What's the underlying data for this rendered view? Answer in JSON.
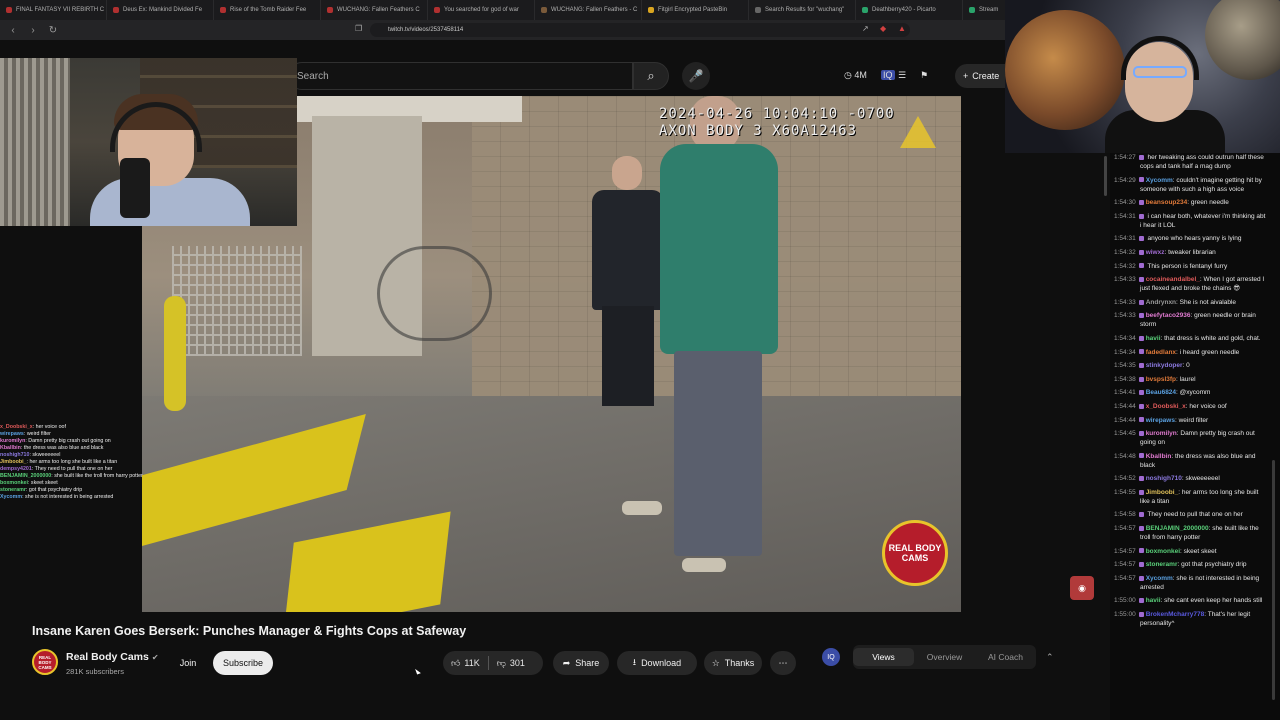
{
  "browser": {
    "tabs": [
      {
        "label": "FINAL FANTASY VII REBIRTH C",
        "color": "#b03030"
      },
      {
        "label": "Deus Ex: Mankind Divided Fe",
        "color": "#b03030"
      },
      {
        "label": "Rise of the Tomb Raider Fee",
        "color": "#b03030"
      },
      {
        "label": "WUCHANG: Fallen Feathers C",
        "color": "#b03030"
      },
      {
        "label": "You searched for god of war",
        "color": "#b03030"
      },
      {
        "label": "WUCHANG: Fallen Feathers - C",
        "color": "#7a5a3a"
      },
      {
        "label": "Fitgirl Encrypted PasteBin",
        "color": "#d9a520"
      },
      {
        "label": "Search Results for \"wuchang\"",
        "color": "#666666"
      },
      {
        "label": "Deathberry420 - Picarto",
        "color": "#2aa36a"
      },
      {
        "label": "Stream",
        "color": "#2aa36a"
      }
    ],
    "url": "twitch.tv/videos/2537458114"
  },
  "header": {
    "search_placeholder": "Search",
    "live_count": "4M",
    "create_label": "Create"
  },
  "video": {
    "timestamp_line1": "2024-04-26 10:04:10 -0700",
    "timestamp_line2": "AXON BODY 3 X60A12463",
    "watermark": "REAL BODY CAMS"
  },
  "overlay_chat": [
    {
      "user": "x_Doobski_x",
      "text": "her voice oof",
      "color": "#e05a5a"
    },
    {
      "user": "wirepaws",
      "text": "weird filter",
      "color": "#5aa0e0"
    },
    {
      "user": "kuromilyn",
      "text": "Damn pretty big crash out going on",
      "color": "#e07ad0"
    },
    {
      "user": "Kballbin",
      "text": "the dress was also blue and black",
      "color": "#e07ad0"
    },
    {
      "user": "noshigh710",
      "text": "skweeeeeel",
      "color": "#8c7ae0"
    },
    {
      "user": "Jimboobi_",
      "text": "her arms too long she built like a titan",
      "color": "#e0c05a"
    },
    {
      "user": "dempsy4201",
      "text": "They need to pull that one on her",
      "color": "#a06bd1"
    },
    {
      "user": "BENJAMIN_2000000",
      "text": "she built like the troll from harry potter",
      "color": "#5ad07a"
    },
    {
      "user": "boxmonkei",
      "text": "skeet skeet",
      "color": "#5ad07a"
    },
    {
      "user": "stoneramr",
      "text": "got that psychiatry drip",
      "color": "#5ad07a"
    },
    {
      "user": "Xycomm",
      "text": "she is not interested in being arrested",
      "color": "#5aa0e0"
    }
  ],
  "meta": {
    "title": "Insane Karen Goes Berserk: Punches Manager & Fights Cops at Safeway",
    "channel": "Real Body Cams",
    "subscribers": "281K subscribers",
    "join": "Join",
    "subscribe": "Subscribe",
    "likes": "11K",
    "dislikes": "301",
    "share": "Share",
    "download": "Download",
    "thanks": "Thanks",
    "avatar_text": "REAL BODY CAMS"
  },
  "stats_panel": {
    "badge": "IQ",
    "tabs": [
      "Views",
      "Overview",
      "AI Coach"
    ],
    "active": "Views"
  },
  "chat": [
    {
      "time": "1:54:27",
      "user": "",
      "text": "her tweaking ass could outrun half these cops and tank half a mag dump",
      "color": "#a06bd1"
    },
    {
      "time": "1:54:29",
      "user": "Xycomm",
      "text": "couldn't imagine getting hit by someone with such a high ass voice",
      "color": "#5aa0e0"
    },
    {
      "time": "1:54:30",
      "user": "beansoup234",
      "text": "green needle",
      "color": "#e07a3a"
    },
    {
      "time": "1:54:31",
      "user": "",
      "text": "i can hear both, whatever i'm thinking abt i hear it LOL",
      "color": "#5a5ae0"
    },
    {
      "time": "1:54:31",
      "user": "",
      "text": "anyone who hears yanny is lying",
      "color": "#5a5ae0"
    },
    {
      "time": "1:54:32",
      "user": "wiwxz",
      "text": "tweaker librarian",
      "color": "#a06bd1"
    },
    {
      "time": "1:54:32",
      "user": "",
      "text": "This person is fentanyl furry",
      "color": "#5a5ae0"
    },
    {
      "time": "1:54:33",
      "user": "cocaineandalbel_",
      "text": "When I got arrested I just flexed and broke the chains 😎",
      "color": "#e05a5a"
    },
    {
      "time": "1:54:33",
      "user": "Andrynxn",
      "text": "She is not aivalable",
      "color": "#9a9a9a"
    },
    {
      "time": "1:54:33",
      "user": "beefytaco2936",
      "text": "green needle or brain storm",
      "color": "#e07ad0"
    },
    {
      "time": "1:54:34",
      "user": "havii",
      "text": "that dress is white and gold, chat.",
      "color": "#5ad07a"
    },
    {
      "time": "1:54:34",
      "user": "fadedlanx",
      "text": "i heard green needle",
      "color": "#e07a3a"
    },
    {
      "time": "1:54:35",
      "user": "stinkydoper",
      "text": "0",
      "color": "#8c7ae0"
    },
    {
      "time": "1:54:38",
      "user": "bvspsl3fp",
      "text": "laurel",
      "color": "#e07a3a"
    },
    {
      "time": "1:54:41",
      "user": "Beau6824",
      "text": "@xycomm",
      "color": "#5aa0e0"
    },
    {
      "time": "1:54:44",
      "user": "x_Doobski_x",
      "text": "her voice oof",
      "color": "#e05a5a"
    },
    {
      "time": "1:54:44",
      "user": "wirepaws",
      "text": "weird filter",
      "color": "#5aa0e0"
    },
    {
      "time": "1:54:45",
      "user": "kuromilyn",
      "text": "Damn pretty big crash out going on",
      "color": "#e07ad0"
    },
    {
      "time": "1:54:48",
      "user": "Kballbin",
      "text": "the dress was also blue and black",
      "color": "#e07ad0"
    },
    {
      "time": "1:54:52",
      "user": "noshigh710",
      "text": "skweeeeeel",
      "color": "#8c7ae0"
    },
    {
      "time": "1:54:55",
      "user": "Jimboobi_",
      "text": "her arms too long she built like a titan",
      "color": "#e0c05a"
    },
    {
      "time": "1:54:58",
      "user": "",
      "text": "They need to pull that one on her",
      "color": "#5a5ae0"
    },
    {
      "time": "1:54:57",
      "user": "BENJAMIN_2000000",
      "text": "she built like the troll from harry potter",
      "color": "#5ad07a"
    },
    {
      "time": "1:54:57",
      "user": "boxmonkei",
      "text": "skeet skeet",
      "color": "#5ad07a"
    },
    {
      "time": "1:54:57",
      "user": "stoneramr",
      "text": "got that psychiatry drip",
      "color": "#5ad07a"
    },
    {
      "time": "1:54:57",
      "user": "Xycomm",
      "text": "she is not interested in being arrested",
      "color": "#5aa0e0"
    },
    {
      "time": "1:55:00",
      "user": "havii",
      "text": "she cant even keep her hands still",
      "color": "#5ad07a"
    },
    {
      "time": "1:55:00",
      "user": "BrokenMcharry778",
      "text": "That's her legit personality^",
      "color": "#5a5ae0"
    }
  ]
}
